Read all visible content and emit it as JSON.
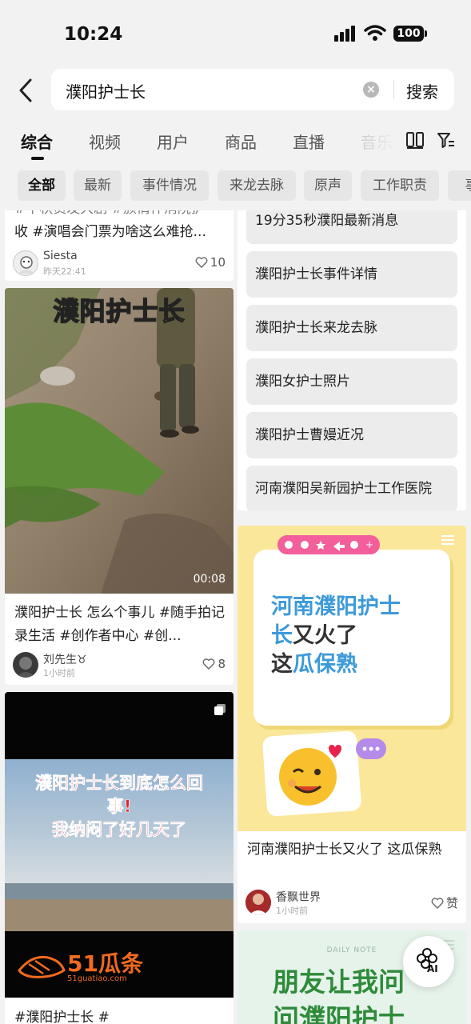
{
  "status_bar": {
    "time": "10:24",
    "battery": "100"
  },
  "search": {
    "query": "濮阳护士长",
    "submit_label": "搜索"
  },
  "tabs": [
    {
      "label": "综合"
    },
    {
      "label": "视频"
    },
    {
      "label": "用户"
    },
    {
      "label": "商品"
    },
    {
      "label": "直播"
    },
    {
      "label": "音乐"
    }
  ],
  "chips": [
    {
      "label": "全部"
    },
    {
      "label": "最新"
    },
    {
      "label": "事件情况"
    },
    {
      "label": "来龙去脉"
    },
    {
      "label": "原声"
    },
    {
      "label": "工作职责"
    },
    {
      "label": "事"
    }
  ],
  "left_column": {
    "card1": {
      "title_partial": "#中秋员发大剧 #颁情伴消院护",
      "title_line2": "收 #演唱会门票为啥这么难抢...",
      "author": "Siesta",
      "time": "昨天22:41",
      "likes": "10"
    },
    "card2": {
      "overlay": "濮阳护士长",
      "duration": "00:08",
      "title": "濮阳护士长 怎么个事儿 #随手拍记录生活 #创作者中心 #创...",
      "author": "刘先生♉",
      "time": "1小时前",
      "likes": "8"
    },
    "card3": {
      "overlay_line1": "濮阳护士长到底怎么回",
      "overlay_line2": "事!",
      "overlay_line3": "我纳闷了好几天了",
      "watermark_brand": "51瓜条",
      "watermark_url": "51guatiao.com",
      "title": "#濮阳护士长 #"
    }
  },
  "right_column": {
    "suggestions": [
      "19分35秒濮阳最新消息",
      "濮阳护士长事件详情",
      "濮阳护士长来龙去脉",
      "濮阳女护士照片",
      "濮阳护士曹嫚近况",
      "河南濮阳吴新园护士工作医院"
    ],
    "card4": {
      "poster_line1": "河南濮阳护士",
      "poster_line2_a": "长",
      "poster_line2_b": "又火了",
      "poster_line3_a": "这",
      "poster_line3_b": "瓜保熟",
      "title": "河南濮阳护士长又火了 这瓜保熟",
      "author": "香飘世界",
      "time": "1小时前",
      "likes": "赞"
    },
    "card5": {
      "tag": "DAILY NOTE",
      "poster_line1": "朋友让我问",
      "poster_line2": "问濮阳护士"
    }
  },
  "ai_button": {
    "label": "AI"
  },
  "colors": {
    "accent_blue": "#3d9ad8",
    "poster_green": "#2e8b3a",
    "watermark_orange": "#f06a1f",
    "overlay_yellow": "#f7e23a"
  }
}
